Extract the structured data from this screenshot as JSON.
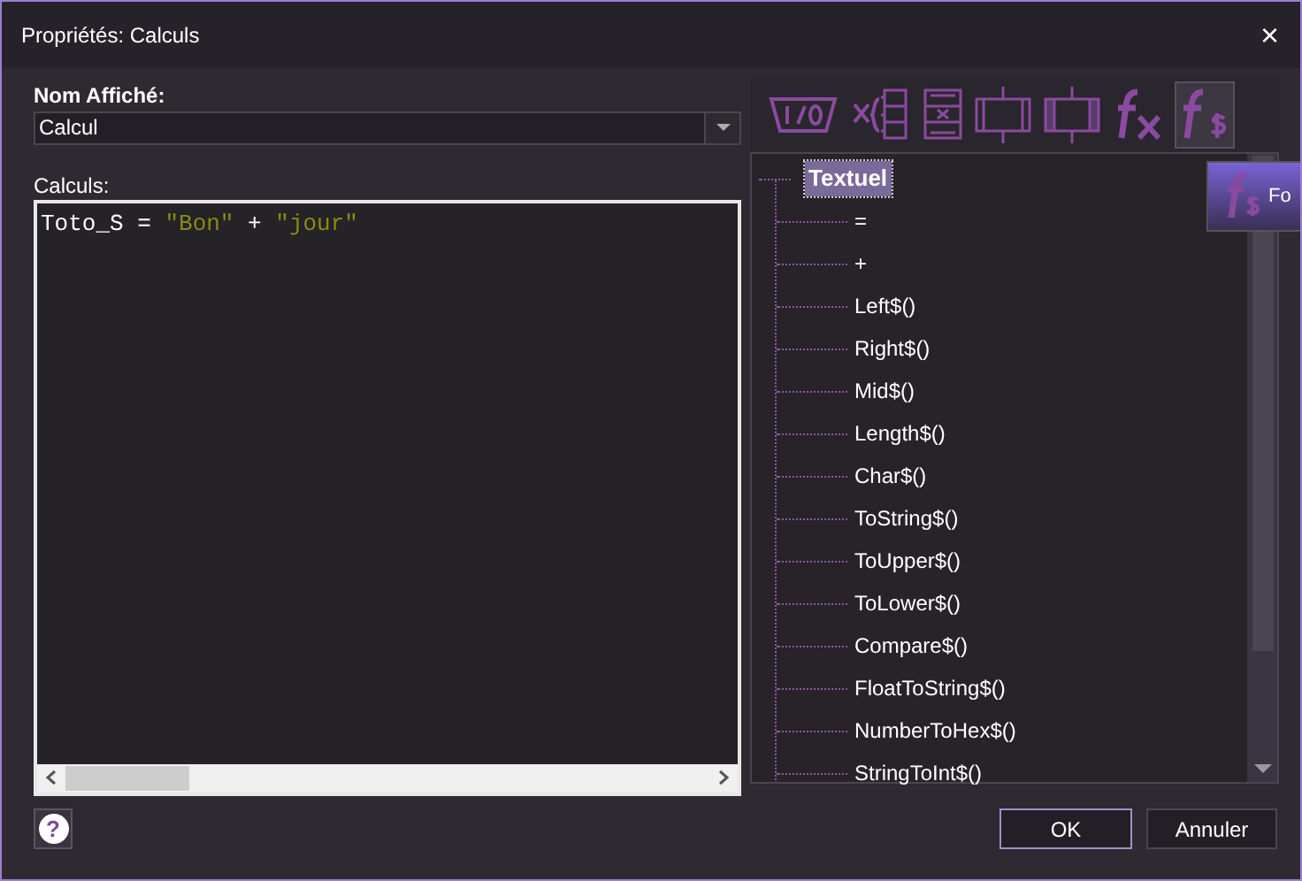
{
  "window": {
    "title": "Propriétés: Calculs",
    "close": "×"
  },
  "name_field": {
    "label": "Nom Affiché:",
    "value": "Calcul"
  },
  "calc_label": "Calculs:",
  "code": [
    {
      "kind": "plain",
      "text": "Toto_S = "
    },
    {
      "kind": "string",
      "text": "\"Bon\""
    },
    {
      "kind": "plain",
      "text": " + "
    },
    {
      "kind": "string",
      "text": "\"jour\""
    }
  ],
  "toolbar": [
    {
      "kind": "io",
      "selected": false
    },
    {
      "kind": "var",
      "selected": false
    },
    {
      "kind": "array",
      "selected": false
    },
    {
      "kind": "block",
      "selected": false
    },
    {
      "kind": "hatched",
      "selected": false
    },
    {
      "kind": "fx",
      "selected": false
    },
    {
      "kind": "fs",
      "selected": true
    }
  ],
  "tooltip": {
    "text": "Fo"
  },
  "tree": {
    "label": "Textuel",
    "selected": true,
    "children": [
      {
        "label": "="
      },
      {
        "label": "+"
      },
      {
        "label": "Left$()"
      },
      {
        "label": "Right$()"
      },
      {
        "label": "Mid$()"
      },
      {
        "label": "Length$()"
      },
      {
        "label": "Char$()"
      },
      {
        "label": "ToString$()"
      },
      {
        "label": "ToUpper$()"
      },
      {
        "label": "ToLower$()"
      },
      {
        "label": "Compare$()"
      },
      {
        "label": "FloatToString$()"
      },
      {
        "label": "NumberToHex$()"
      },
      {
        "label": "StringToInt$()"
      }
    ]
  },
  "buttons": [
    {
      "label": "OK",
      "selected": true
    },
    {
      "label": "Annuler",
      "selected": false
    }
  ],
  "help": "?"
}
